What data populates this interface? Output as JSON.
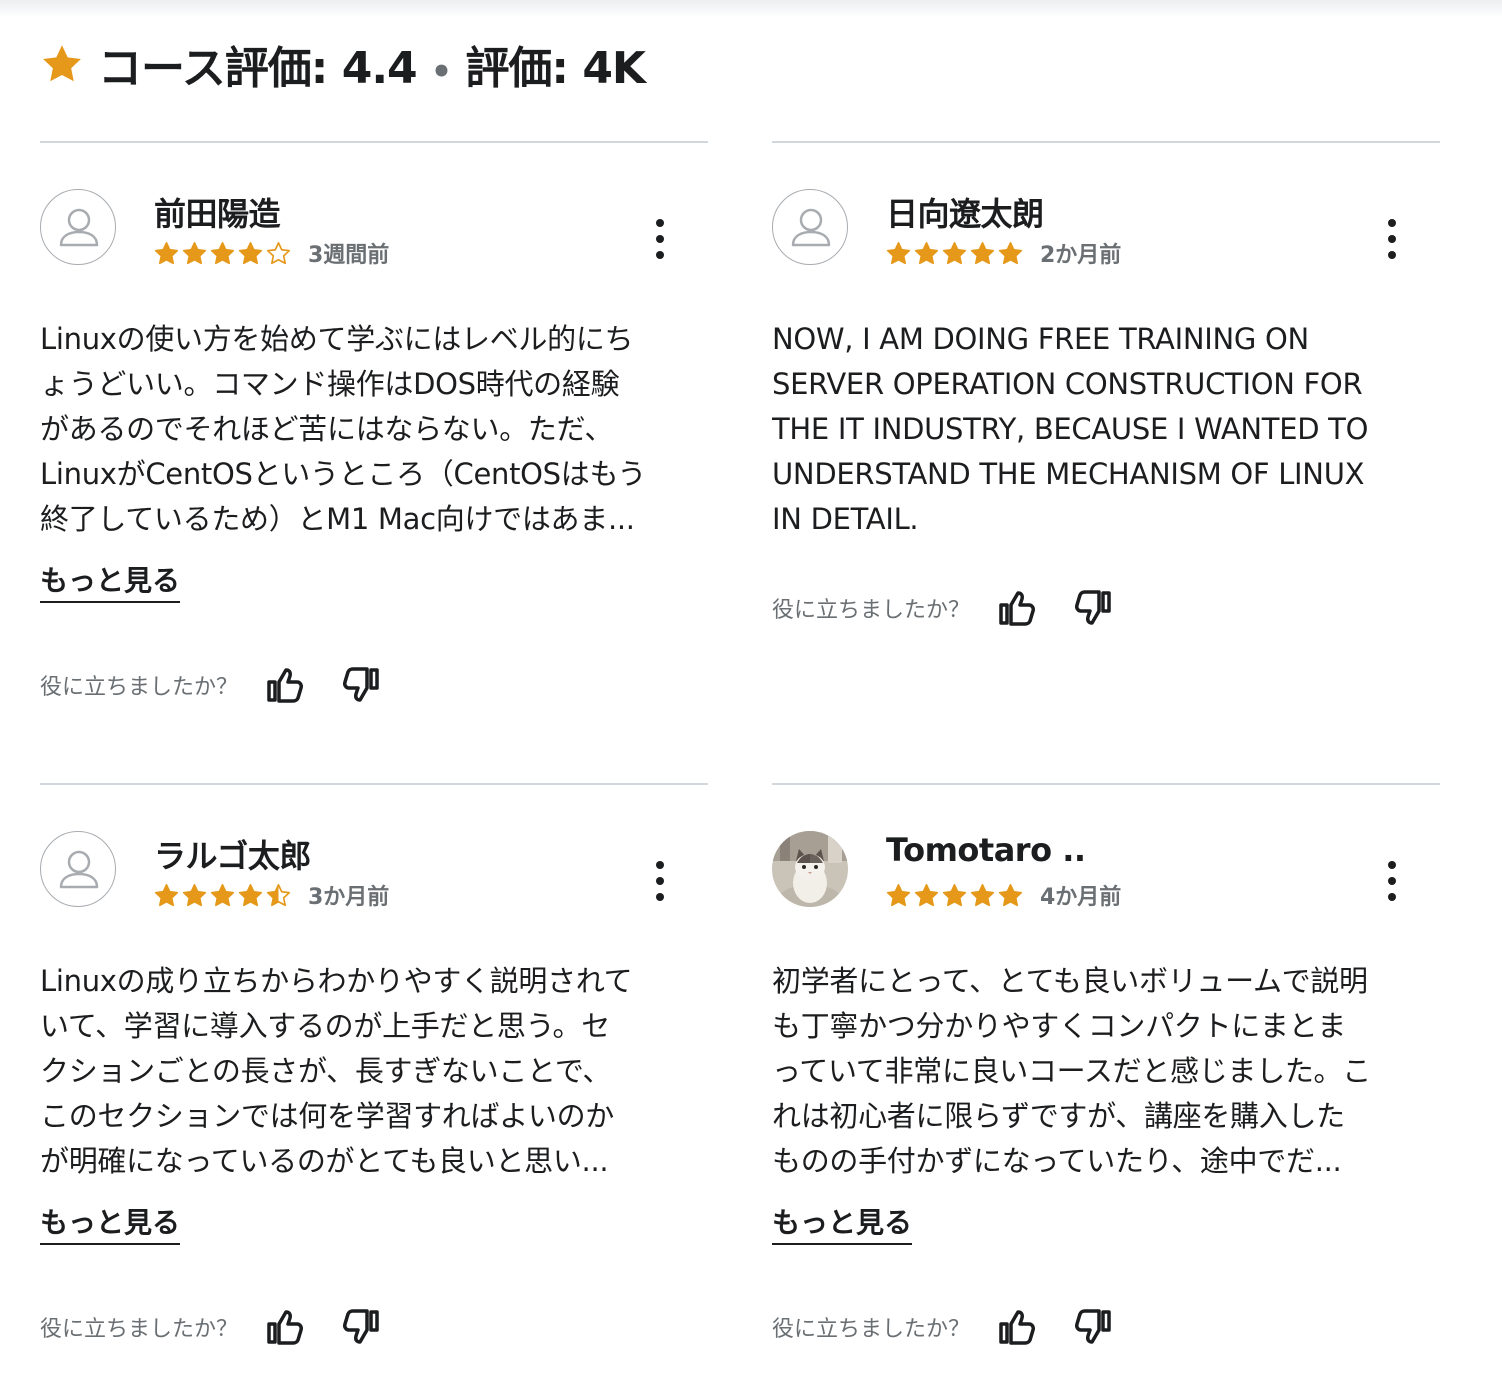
{
  "header": {
    "rating_text": "コース評価: 4.4",
    "separator": "•",
    "count_text": "評価: 4K",
    "star_color": "#e59819"
  },
  "reviews": [
    {
      "name": "前田陽造",
      "rating": 4,
      "time": "3週間前",
      "avatar": "default-avatar-icon",
      "lines": [
        "Linuxの使い方を始めて学ぶにはレベル的にち",
        "ょうどいい。コマンド操作はDOS時代の経験",
        "があるのでそれほど苦にはならない。ただ、",
        "LinuxがCentOSというところ（CentOSはもう",
        "終了しているため）とM1 Mac向けではあま..."
      ],
      "more": "もっと見る",
      "helpful": "役に立ちましたか？"
    },
    {
      "name": "日向遼太朗",
      "rating": 5,
      "time": "2か月前",
      "avatar": "default-avatar-icon",
      "lines": [
        "NOW, I AM DOING FREE TRAINING ON",
        "SERVER OPERATION CONSTRUCTION FOR",
        "THE IT INDUSTRY, BECAUSE I WANTED TO",
        "UNDERSTAND THE MECHANISM OF LINUX",
        "IN DETAIL."
      ],
      "more": "",
      "helpful": "役に立ちましたか？"
    },
    {
      "name": "ラルゴ太郎",
      "rating": 4.5,
      "time": "3か月前",
      "avatar": "default-avatar-icon",
      "lines": [
        "Linuxの成り立ちからわかりやすく説明されて",
        "いて、学習に導入するのが上手だと思う。セ",
        "クションごとの長さが、長すぎないことで、",
        "このセクションでは何を学習すればよいのか",
        "が明確になっているのがとても良いと思い..."
      ],
      "more": "もっと見る",
      "helpful": "役に立ちましたか？"
    },
    {
      "name": "Tomotaro ..",
      "rating": 5,
      "time": "4か月前",
      "avatar": "cat-photo-avatar",
      "lines": [
        "初学者にとって、とても良いボリュームで説明",
        "も丁寧かつ分かりやすくコンパクトにまとま",
        "っていて非常に良いコースだと感じました。こ",
        "れは初心者に限らずですが、講座を購入した",
        "ものの手付かずになっていたり、途中でだ..."
      ],
      "more": "もっと見る",
      "helpful": "役に立ちましたか？"
    }
  ]
}
